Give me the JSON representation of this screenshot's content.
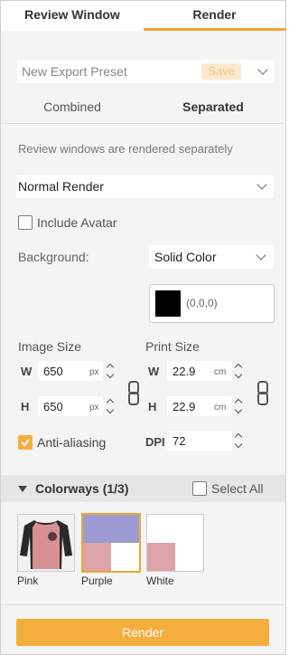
{
  "tabs": [
    {
      "label": "Review Window",
      "active": false
    },
    {
      "label": "Render",
      "active": true
    }
  ],
  "preset": {
    "name": "New Export Preset",
    "save_label": "Save"
  },
  "mode_segments": [
    {
      "label": "Combined",
      "active": false
    },
    {
      "label": "Separated",
      "active": true
    }
  ],
  "message": "Review windows are rendered separately",
  "render_type": {
    "selected": "Normal Render"
  },
  "include_avatar": {
    "label": "Include Avatar",
    "checked": false
  },
  "background": {
    "label": "Background:",
    "selected": "Solid Color",
    "color_value": "(0,0,0)",
    "color_hex": "#000000"
  },
  "image_size": {
    "title": "Image Size",
    "w_label": "W",
    "w": "650",
    "w_unit": "px",
    "h_label": "H",
    "h": "650",
    "h_unit": "px"
  },
  "print_size": {
    "title": "Print Size",
    "w_label": "W",
    "w": "22.9",
    "w_unit": "cm",
    "h_label": "H",
    "h": "22.9",
    "h_unit": "cm"
  },
  "anti_aliasing": {
    "label": "Anti-aliasing",
    "checked": true
  },
  "dpi": {
    "label": "DPI",
    "value": "72"
  },
  "colorways": {
    "title": "Colorways (1/3)",
    "select_all_label": "Select All",
    "items": [
      {
        "label": "Pink",
        "selected": false
      },
      {
        "label": "Purple",
        "selected": true
      },
      {
        "label": "White",
        "selected": false
      }
    ]
  },
  "render_button": "Render",
  "colors": {
    "accent": "#f5ae3d",
    "tab_underline": "#f2a531",
    "swatch_pink": "#dca4a8",
    "swatch_purple": "#9b9bd2"
  }
}
